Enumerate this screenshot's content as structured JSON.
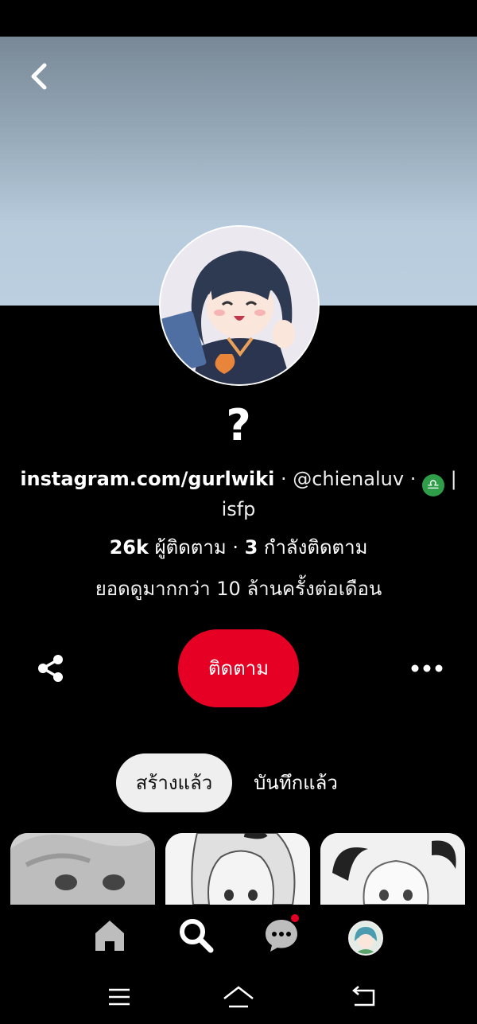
{
  "profile": {
    "name": "?",
    "bio_link": "instagram.com/gurlwiki",
    "bio_sep": " · ",
    "bio_handle": "@chienaluv",
    "zodiac_icon": "libra-icon",
    "zodiac_glyph": "♎",
    "bio_tail": " | isfp",
    "followers_count": "26k",
    "followers_label": "ผู้ติดตาม",
    "stats_sep": " · ",
    "following_count": "3",
    "following_label": "กำลังติดตาม",
    "monthly_views": "ยอดดูมากกว่า 10 ล้านครั้งต่อเดือน"
  },
  "actions": {
    "share_icon": "share-icon",
    "follow_label": "ติดตาม",
    "more_icon": "more-horizontal-icon"
  },
  "tabs": [
    {
      "label": "สร้างแล้ว",
      "selected": true
    },
    {
      "label": "บันทึกแล้ว",
      "selected": false
    }
  ],
  "bottom_nav": [
    {
      "icon": "home-icon"
    },
    {
      "icon": "search-icon",
      "active": true
    },
    {
      "icon": "chat-icon",
      "notification": true
    },
    {
      "icon": "profile-avatar"
    }
  ],
  "system_nav": [
    {
      "icon": "recents-icon"
    },
    {
      "icon": "home-system-icon"
    },
    {
      "icon": "back-system-icon"
    }
  ],
  "colors": {
    "accent": "#e60023",
    "badge_green": "#2f9e48",
    "background": "#000000"
  }
}
